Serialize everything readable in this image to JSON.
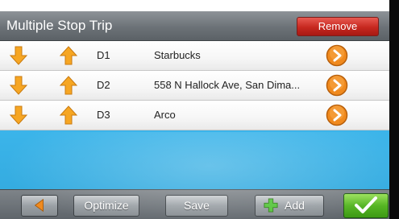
{
  "header": {
    "title": "Multiple Stop Trip",
    "remove_label": "Remove"
  },
  "stops": [
    {
      "id": "D1",
      "name": "Starbucks"
    },
    {
      "id": "D2",
      "name": "558 N Hallock Ave, San Dima..."
    },
    {
      "id": "D3",
      "name": "Arco"
    }
  ],
  "toolbar": {
    "optimize_label": "Optimize",
    "save_label": "Save",
    "add_label": "Add"
  },
  "icons": {
    "move_down": "arrow-down-icon",
    "move_up": "arrow-up-icon",
    "go": "chevron-right-circle-icon",
    "back": "back-arrow-icon",
    "add": "plus-icon",
    "confirm": "checkmark-icon"
  },
  "colors": {
    "accent_blue": "#3fbaf0",
    "remove_red": "#c6281f",
    "arrow_orange": "#f6a623",
    "confirm_green": "#55b523"
  }
}
